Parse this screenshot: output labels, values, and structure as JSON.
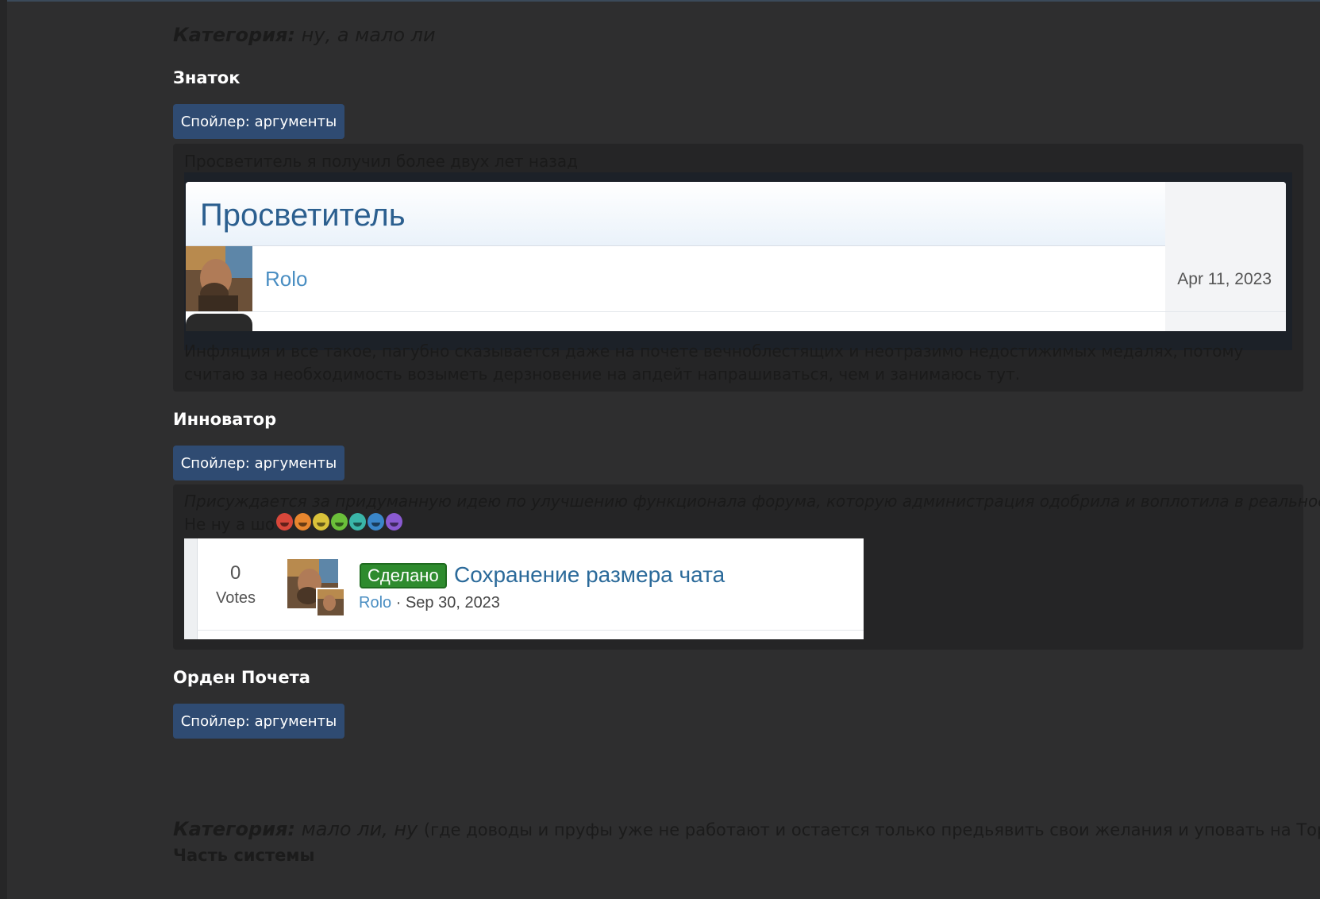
{
  "category1": {
    "label": "Категория:",
    "text": "ну, а мало ли"
  },
  "medals": [
    {
      "title": "Знаток",
      "spoiler_label": "Спойлер: аргументы",
      "intro": "Просветитель я получил более двух лет назад",
      "dialog": {
        "title": "Просветитель",
        "close_icon": "×",
        "user": "Rolo",
        "date": "Apr 11, 2023"
      },
      "body": "Инфляция и все такое, пагубно сказывается даже на почете вечноблестящих и неотразимо недостижимых медалях, потому считаю за необходимость возыметь дерзновение на апдейт напрашиваться, чем и занимаюсь тут."
    },
    {
      "title": "Инноватор",
      "spoiler_label": "Спойлер: аргументы",
      "intro": "Присуждается за придуманную идею по улучшению функционала форума, которую администрация одобрила и воплотила в реальность",
      "remark": "Не ну а шо",
      "emoji_colors": [
        "#d9473a",
        "#e8862e",
        "#d9c23a",
        "#6bbf3a",
        "#3ab5a8",
        "#3a86c9",
        "#8a5ad1"
      ],
      "suggestion": {
        "votes": "0",
        "votes_label": "Votes",
        "status": "Сделано",
        "title": "Сохранение размера чата",
        "author": "Rolo",
        "separator": "·",
        "date": "Sep 30, 2023"
      }
    },
    {
      "title": "Орден Почета",
      "spoiler_label": "Спойлер: аргументы"
    }
  ],
  "category2": {
    "label": "Категория:",
    "text": "мало ли, ну",
    "note": "(где доводы и пруфы уже не работают и остается только предьявить свои желания и уповать на Тора)",
    "subtitle": "Часть системы"
  }
}
